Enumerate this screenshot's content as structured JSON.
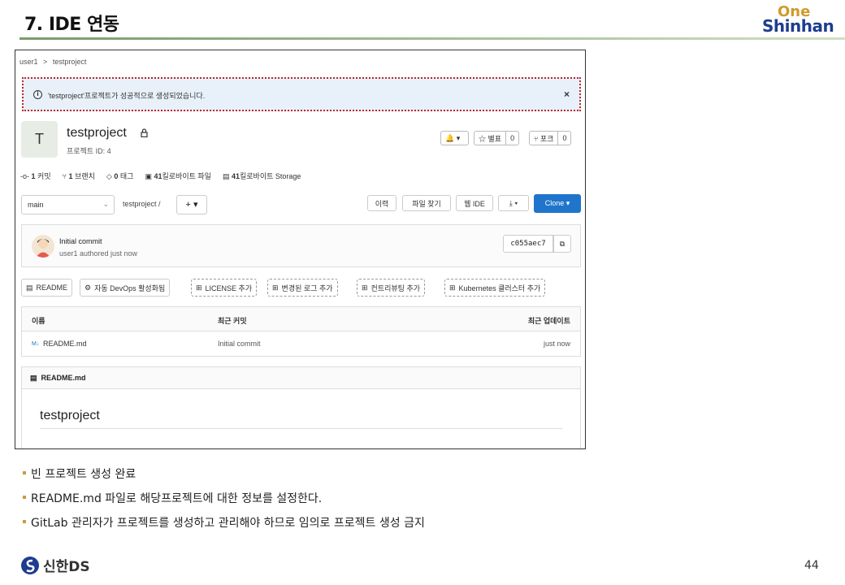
{
  "slide": {
    "title": "7. IDE 연동",
    "logo_top": "One",
    "logo_bottom": "Shinhan",
    "bullets": [
      "빈 프로젝트  생성 완료",
      "README.md 파일로 해당프로젝트에 대한 정보를 설정한다.",
      "GitLab 관리자가 프로젝트를 생성하고 관리해야 하므로 임의로 프로젝트 생성 금지"
    ],
    "footer_logo": "신한DS",
    "page_number": "44"
  },
  "gitlab": {
    "breadcrumb": [
      "user1",
      ">",
      "testproject"
    ],
    "alert_message": "'testproject'프로젝트가 성공적으로 생성되었습니다.",
    "alert_close": "×",
    "avatar_letter": "T",
    "project_name": "testproject",
    "project_id": "프로젝트 ID: 4",
    "notify_label": "🔔 ▾",
    "star_label": "☆ 별표",
    "star_count": "0",
    "fork_label": "⑂ 포크",
    "fork_count": "0",
    "stats": [
      {
        "icon": "-o-",
        "count": "1",
        "label": "커밋"
      },
      {
        "icon": "⑂",
        "count": "1",
        "label": "브랜치"
      },
      {
        "icon": "◇",
        "count": "0",
        "label": "태그"
      },
      {
        "icon": "▣",
        "count": "41",
        "label": "킬로바이트 파일"
      },
      {
        "icon": "▤",
        "count": "41",
        "label": "킬로바이트 Storage"
      }
    ],
    "branch": "main",
    "path": "testproject  /",
    "plus_button": "+ ▾",
    "history_button": "이력",
    "find_file_button": "파일 찾기",
    "web_ide_button": "웹 IDE",
    "download_button": "⤓ ▾",
    "clone_button": "Clone ▾",
    "commit": {
      "title": "Initial commit",
      "subtitle": "user1 authored just now",
      "sha": "c055aec7",
      "copy_icon": "⧉"
    },
    "quick_actions": [
      {
        "icon": "▤",
        "label": "README"
      },
      {
        "icon": "⚙",
        "label": "자동 DevOps 활성화됨"
      },
      {
        "icon": "⊞",
        "label": "LICENSE 추가"
      },
      {
        "icon": "⊞",
        "label": "변경된 로그 추가"
      },
      {
        "icon": "⊞",
        "label": "컨트리뷰팅 추가"
      },
      {
        "icon": "⊞",
        "label": "Kubernetes 클러스터 추가"
      }
    ],
    "table": {
      "headers": [
        "이름",
        "최근 커밋",
        "최근 업데이트"
      ],
      "rows": [
        {
          "icon": "M↓",
          "name": "README.md",
          "commit": "Initial commit",
          "updated": "just now"
        }
      ]
    },
    "readme": {
      "header": "README.md",
      "heading": "testproject"
    }
  }
}
